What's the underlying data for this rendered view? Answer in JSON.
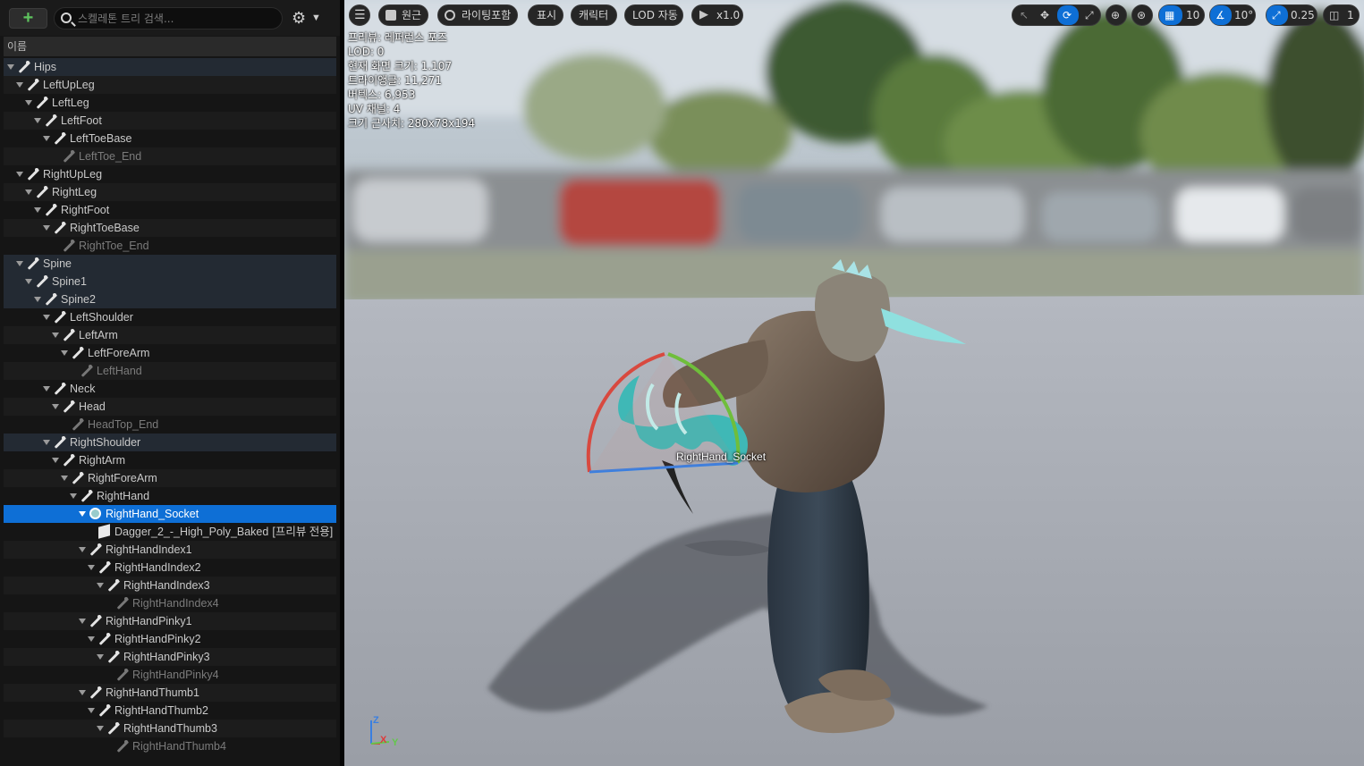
{
  "left_panel": {
    "add_label": "+",
    "search_placeholder": "스켈레톤 트리 검색...",
    "settings_icon": "gear-icon",
    "column_header": "이름",
    "preview_only_tag": "[프리뷰 전용]",
    "tree": [
      {
        "label": "Hips",
        "depth": 0,
        "kind": "bone",
        "expanded": true
      },
      {
        "label": "LeftUpLeg",
        "depth": 1,
        "kind": "bone",
        "expanded": true
      },
      {
        "label": "LeftLeg",
        "depth": 2,
        "kind": "bone",
        "expanded": true
      },
      {
        "label": "LeftFoot",
        "depth": 3,
        "kind": "bone",
        "expanded": true
      },
      {
        "label": "LeftToeBase",
        "depth": 4,
        "kind": "bone",
        "expanded": true
      },
      {
        "label": "LeftToe_End",
        "depth": 5,
        "kind": "bone",
        "muted": true
      },
      {
        "label": "RightUpLeg",
        "depth": 1,
        "kind": "bone",
        "expanded": true
      },
      {
        "label": "RightLeg",
        "depth": 2,
        "kind": "bone",
        "expanded": true
      },
      {
        "label": "RightFoot",
        "depth": 3,
        "kind": "bone",
        "expanded": true
      },
      {
        "label": "RightToeBase",
        "depth": 4,
        "kind": "bone",
        "expanded": true
      },
      {
        "label": "RightToe_End",
        "depth": 5,
        "kind": "bone",
        "muted": true
      },
      {
        "label": "Spine",
        "depth": 1,
        "kind": "bone",
        "expanded": true
      },
      {
        "label": "Spine1",
        "depth": 2,
        "kind": "bone",
        "expanded": true
      },
      {
        "label": "Spine2",
        "depth": 3,
        "kind": "bone",
        "expanded": true
      },
      {
        "label": "LeftShoulder",
        "depth": 4,
        "kind": "bone",
        "expanded": true
      },
      {
        "label": "LeftArm",
        "depth": 5,
        "kind": "bone",
        "expanded": true
      },
      {
        "label": "LeftForeArm",
        "depth": 6,
        "kind": "bone",
        "expanded": true
      },
      {
        "label": "LeftHand",
        "depth": 7,
        "kind": "bone",
        "muted": true
      },
      {
        "label": "Neck",
        "depth": 4,
        "kind": "bone",
        "expanded": true
      },
      {
        "label": "Head",
        "depth": 5,
        "kind": "bone",
        "expanded": true
      },
      {
        "label": "HeadTop_End",
        "depth": 6,
        "kind": "bone",
        "muted": true
      },
      {
        "label": "RightShoulder",
        "depth": 4,
        "kind": "bone",
        "expanded": true
      },
      {
        "label": "RightArm",
        "depth": 5,
        "kind": "bone",
        "expanded": true
      },
      {
        "label": "RightForeArm",
        "depth": 6,
        "kind": "bone",
        "expanded": true
      },
      {
        "label": "RightHand",
        "depth": 7,
        "kind": "bone",
        "expanded": true
      },
      {
        "label": "RightHand_Socket",
        "depth": 8,
        "kind": "socket",
        "expanded": true,
        "selected": true
      },
      {
        "label": "Dagger_2_-_High_Poly_Baked",
        "depth": 9,
        "kind": "mesh",
        "preview": true
      },
      {
        "label": "RightHandIndex1",
        "depth": 8,
        "kind": "bone",
        "expanded": true
      },
      {
        "label": "RightHandIndex2",
        "depth": 9,
        "kind": "bone",
        "expanded": true
      },
      {
        "label": "RightHandIndex3",
        "depth": 10,
        "kind": "bone",
        "expanded": true
      },
      {
        "label": "RightHandIndex4",
        "depth": 11,
        "kind": "bone",
        "muted": true
      },
      {
        "label": "RightHandPinky1",
        "depth": 8,
        "kind": "bone",
        "expanded": true
      },
      {
        "label": "RightHandPinky2",
        "depth": 9,
        "kind": "bone",
        "expanded": true
      },
      {
        "label": "RightHandPinky3",
        "depth": 10,
        "kind": "bone",
        "expanded": true
      },
      {
        "label": "RightHandPinky4",
        "depth": 11,
        "kind": "bone",
        "muted": true
      },
      {
        "label": "RightHandThumb1",
        "depth": 8,
        "kind": "bone",
        "expanded": true
      },
      {
        "label": "RightHandThumb2",
        "depth": 9,
        "kind": "bone",
        "expanded": true
      },
      {
        "label": "RightHandThumb3",
        "depth": 10,
        "kind": "bone",
        "expanded": true
      },
      {
        "label": "RightHandThumb4",
        "depth": 11,
        "kind": "bone",
        "muted": true
      }
    ]
  },
  "viewport": {
    "toolbar": {
      "menu_icon": "hamburger-icon",
      "perspective_label": "원근",
      "lighting_label": "라이팅포함",
      "show_label": "표시",
      "character_label": "캐릭터",
      "lod_label": "LOD 자동",
      "playback_label": "x1.0",
      "grid_snap_value": "10",
      "rotate_snap_value": "10°",
      "scale_snap_value": "0.25",
      "camera_speed_value": "1"
    },
    "stats": [
      "프리뷰: 레퍼런스 포즈",
      "LOD: 0",
      "현재 화면 크기: 1.107",
      "트라이앵글: 11,271",
      "버텍스: 6,953",
      "UV 채널: 4",
      "크기 근사치: 280x78x194"
    ],
    "socket_label": "RightHand_Socket",
    "axis_labels": {
      "x": "X",
      "y": "Y",
      "z": "Z"
    }
  },
  "colors": {
    "selection": "#0e6fd6",
    "add_icon": "#5ec35e",
    "axis_x": "#e03a3a",
    "axis_y": "#62c84a",
    "axis_z": "#3a7fe0"
  }
}
